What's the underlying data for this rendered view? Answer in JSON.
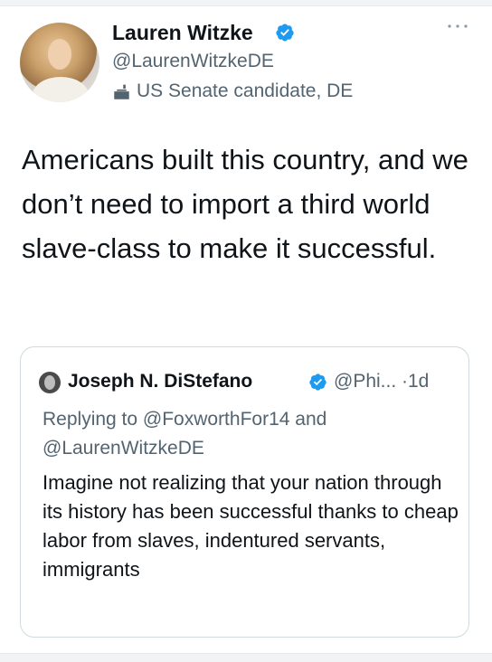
{
  "author": {
    "display_name": "Lauren Witzke",
    "handle": "@LaurenWitzkeDE",
    "bio": "US Senate candidate, DE",
    "verified": true
  },
  "tweet": {
    "text": "Americans built this country, and we don’t need to import a third world slave-class to make it successful."
  },
  "quoted_tweet": {
    "display_name": "Joseph N. DiStefano",
    "meta": "@Phi... ·1d",
    "verified": true,
    "reply_context": "Replying to @FoxworthFor14 and @LaurenWitzkeDE",
    "text": "Imagine not realizing that your nation through its history has been successful thanks to cheap labor from slaves, indentured servants, immigrants"
  },
  "icons": {
    "verified": "verified-badge-icon",
    "more": "more-horizontal-icon",
    "bio": "briefcase-icon"
  },
  "colors": {
    "verified_blue": "#1d9bf0",
    "secondary_text": "#536471",
    "primary_text": "#0f1419",
    "card_border": "#cfd9de"
  }
}
